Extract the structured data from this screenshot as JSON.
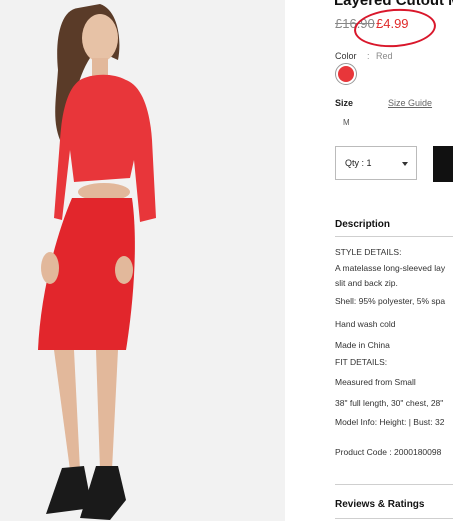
{
  "product": {
    "title": "Layered Cutout M",
    "old_price": "£16.90",
    "new_price": "£4.99",
    "color_label": "Color",
    "color_sep": ":",
    "color_value": "Red",
    "swatch_color": "#e8363a",
    "size_label": "Size",
    "size_guide": "Size Guide",
    "size_option": "M",
    "qty_label": "Qty : 1"
  },
  "description": {
    "heading": "Description",
    "lines": [
      "STYLE DETAILS:",
      "A matelasse long-sleeved lay",
      "slit and back zip.",
      "Shell: 95% polyester, 5% spa",
      "Hand wash cold",
      "Made in China",
      "FIT DETAILS:",
      "Measured from Small",
      "38\" full length, 30\" chest, 28\"",
      "Model Info: Height: | Bust: 32",
      "Product Code : 2000180098"
    ]
  },
  "reviews_heading": "Reviews & Ratings",
  "colors": {
    "accent_red": "#e02a2a",
    "annotation_circle": "#d9172b",
    "dress": "#e8363a"
  }
}
